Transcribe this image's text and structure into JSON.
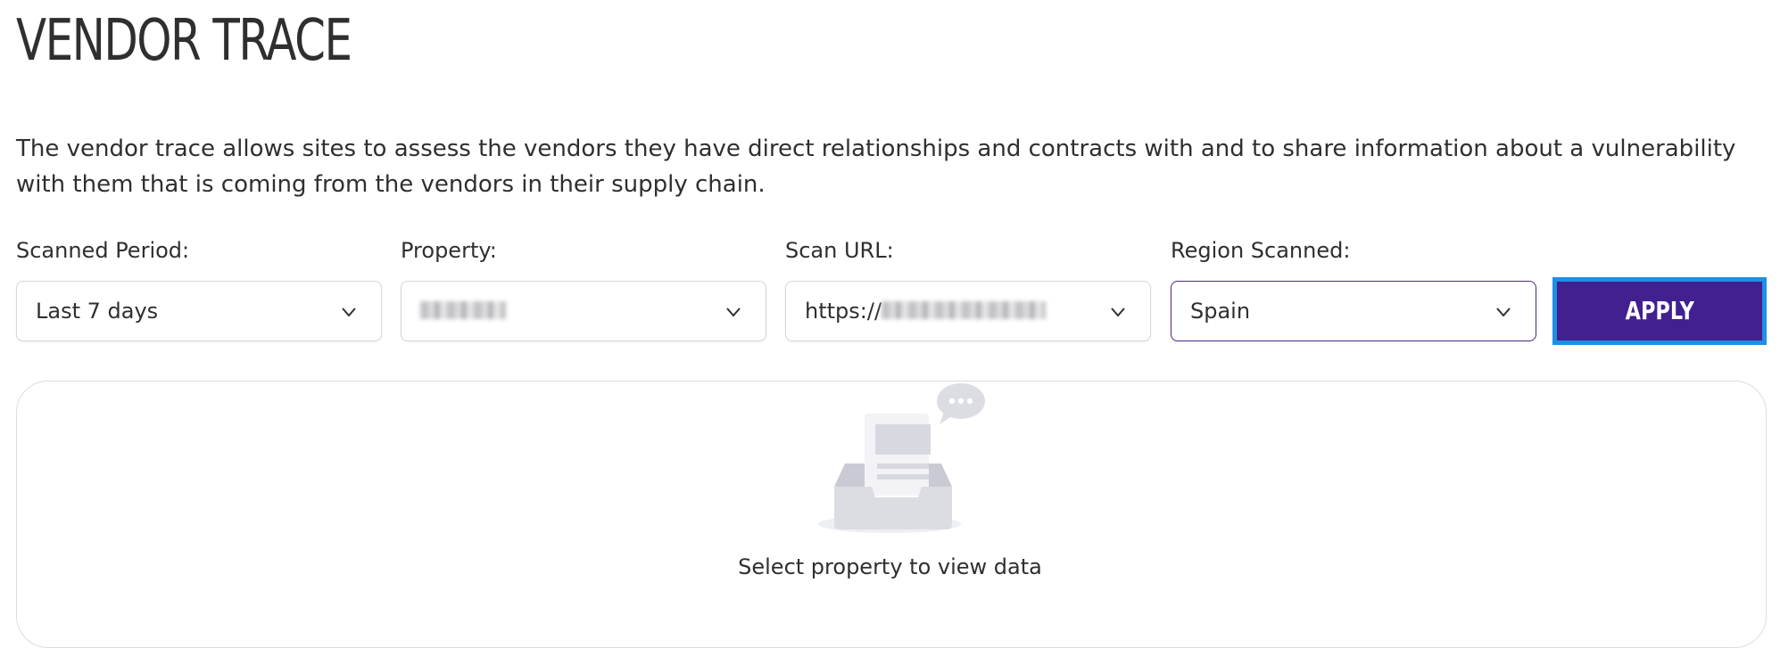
{
  "header": {
    "title": "VENDOR TRACE"
  },
  "intro": {
    "description": "The vendor trace allows sites to assess the vendors they have direct relationships and contracts with and to share information about a vulnerability with them that is coming from the vendors in their supply chain."
  },
  "filters": {
    "scanned_period": {
      "label": "Scanned Period:",
      "value": "Last 7 days"
    },
    "property": {
      "label": "Property:",
      "value": ""
    },
    "scan_url": {
      "label": "Scan URL:",
      "value": "https://"
    },
    "region_scanned": {
      "label": "Region Scanned:",
      "value": "Spain"
    },
    "apply_label": "APPLY"
  },
  "empty_state": {
    "icon": "empty-inbox-icon",
    "message": "Select property to view data"
  },
  "colors": {
    "accent": "#43208f",
    "focus_ring": "#1e8fe6",
    "border": "#d6d6dc"
  }
}
